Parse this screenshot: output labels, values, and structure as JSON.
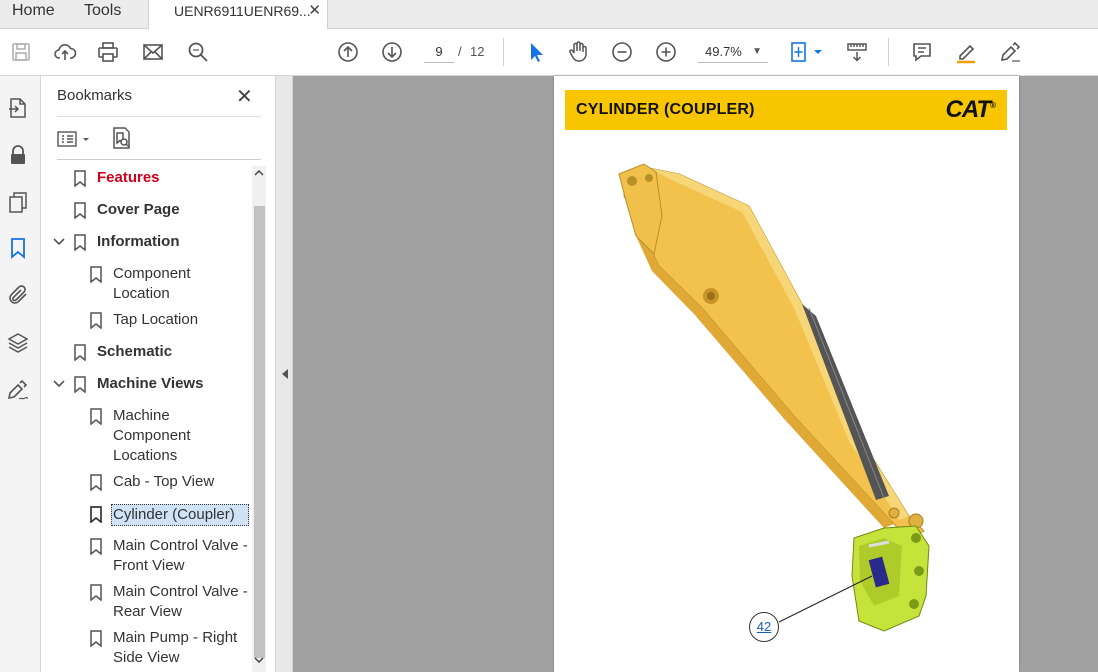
{
  "tabs": {
    "home": "Home",
    "tools": "Tools",
    "document": "UENR6911UENR69...",
    "document_close": "✕"
  },
  "toolbar": {
    "page_current": "9",
    "page_separator": "/",
    "page_total": "12",
    "zoom": "49.7%"
  },
  "bookmarks_panel": {
    "title": "Bookmarks",
    "close": "✕",
    "items": [
      {
        "label": "Features",
        "level": 0,
        "bold": true,
        "color": "#d0021b"
      },
      {
        "label": "Cover Page",
        "level": 0,
        "bold": true
      },
      {
        "label": "Information",
        "level": 0,
        "bold": true,
        "expanded": true
      },
      {
        "label_lines": [
          "Component",
          "Location"
        ],
        "level": 1
      },
      {
        "label": "Tap Location",
        "level": 1
      },
      {
        "label": "Schematic",
        "level": 0,
        "bold": true
      },
      {
        "label": "Machine Views",
        "level": 0,
        "bold": true,
        "expanded": true
      },
      {
        "label_lines": [
          "Machine",
          "Component",
          "Locations"
        ],
        "level": 1
      },
      {
        "label": "Cab - Top View",
        "level": 1
      },
      {
        "label": "Cylinder (Coupler)",
        "level": 1,
        "selected": true
      },
      {
        "label_lines": [
          "Main Control Valve -",
          "Front View"
        ],
        "level": 1
      },
      {
        "label_lines": [
          "Main Control Valve -",
          "Rear View"
        ],
        "level": 1
      },
      {
        "label_lines": [
          "Main Pump - Right",
          "Side View"
        ],
        "level": 1
      }
    ]
  },
  "document": {
    "banner_title": "CYLINDER (COUPLER)",
    "logo": "CAT",
    "callout": "42",
    "colors": {
      "banner": "#f7c600",
      "boom": "#f2c24c",
      "coupler": "#c6e33c"
    }
  },
  "icons": {
    "toolbar": [
      "save-icon",
      "upload-icon",
      "print-icon",
      "email-icon",
      "find-icon",
      "prev-page-icon",
      "next-page-icon",
      "select-cursor-icon",
      "hand-icon",
      "zoom-out-icon",
      "zoom-in-icon",
      "fit-page-icon",
      "scroll-mode-icon",
      "comment-icon",
      "highlight-icon",
      "sign-icon"
    ],
    "rail": [
      "export-pdf-icon",
      "lock-icon",
      "pages-icon",
      "bookmark-icon",
      "attachment-icon",
      "layers-icon",
      "sign-icon"
    ]
  }
}
